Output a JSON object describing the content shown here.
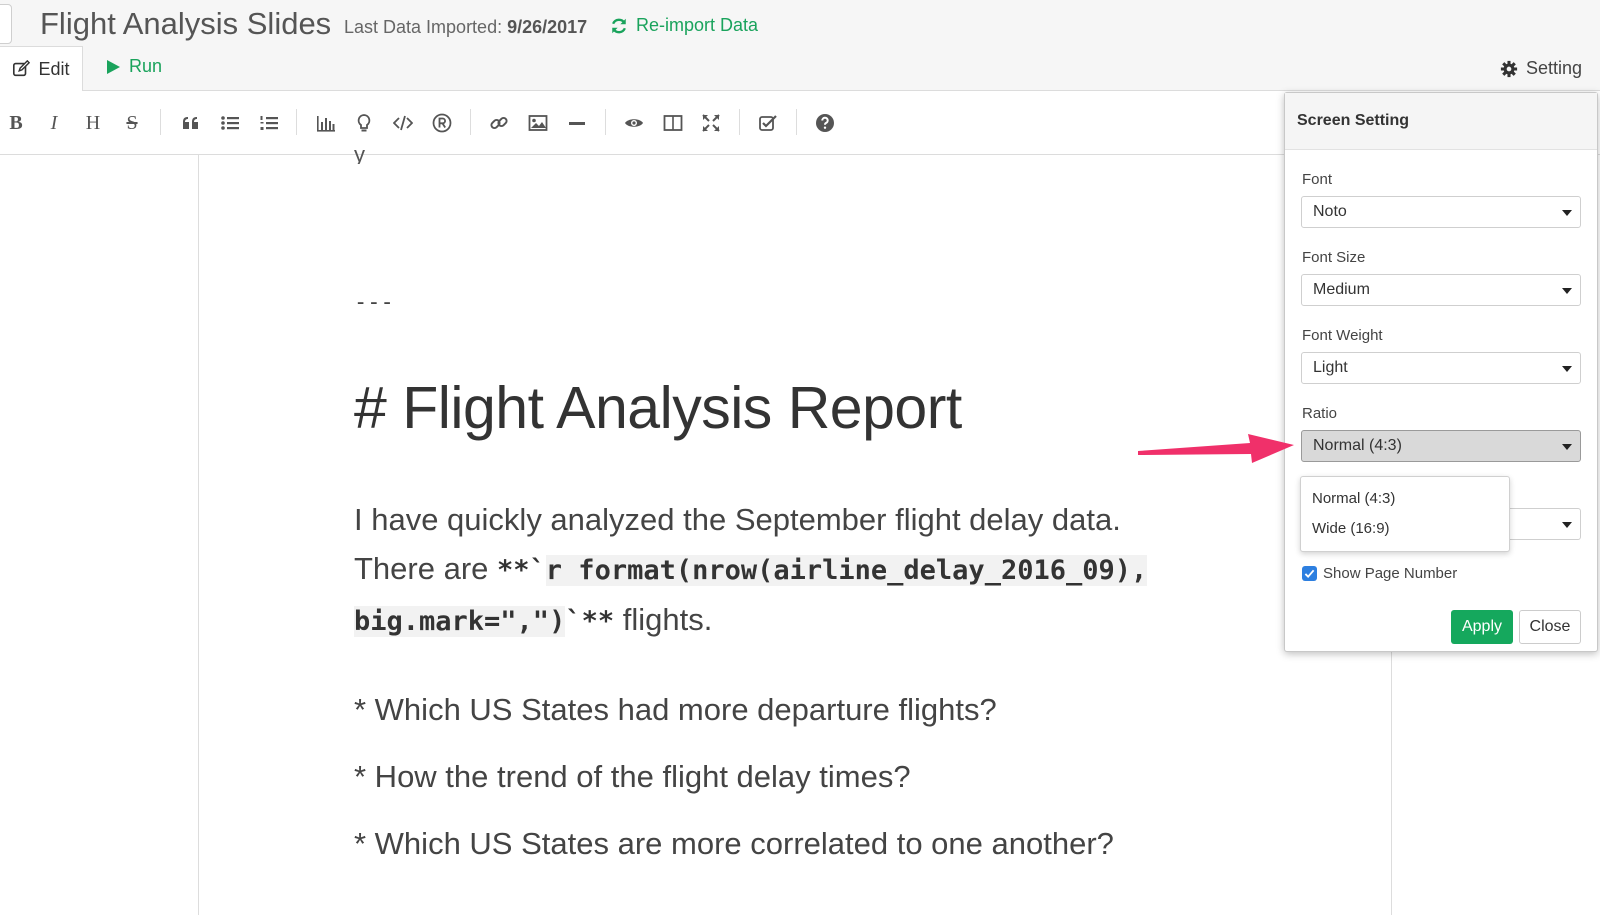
{
  "header": {
    "title": "Flight Analysis Slides",
    "imported_label": "Last Data Imported:",
    "imported_date": "9/26/2017",
    "reimport_label": "Re-import Data"
  },
  "tabs": {
    "edit": "Edit",
    "run": "Run"
  },
  "setting_label": "Setting",
  "toolbar": {
    "items": [
      "bold",
      "italic",
      "heading",
      "strikethrough",
      "quote",
      "unordered-list",
      "ordered-list",
      "chart",
      "hint",
      "code",
      "registered",
      "link",
      "image",
      "horizontal-rule",
      "preview",
      "side-by-side",
      "fullscreen",
      "checklist",
      "help"
    ],
    "bold": "B",
    "italic": "I",
    "heading": "H",
    "strike": "S"
  },
  "editor": {
    "clipped_line": "y",
    "separator": "---",
    "heading": "# Flight Analysis Report",
    "para_line1": "I have quickly analyzed the September flight delay data.",
    "para_there_are": "There are ",
    "para_stars_open": "**`",
    "para_code1": "r format(nrow(airline_delay_2016_09),",
    "para_code2": "big.mark=\",\")",
    "para_stars_close": "`**",
    "para_flights": " flights.",
    "bullets": [
      "* Which US States had more departure flights?",
      "* How the trend of the flight delay times?",
      "* Which US States are more correlated to one another?"
    ]
  },
  "screen_setting": {
    "title": "Screen Setting",
    "font_label": "Font",
    "font_value": "Noto",
    "font_size_label": "Font Size",
    "font_size_value": "Medium",
    "font_weight_label": "Font Weight",
    "font_weight_value": "Light",
    "ratio_label": "Ratio",
    "ratio_value": "Normal (4:3)",
    "ratio_options": [
      "Normal (4:3)",
      "Wide (16:9)"
    ],
    "show_page_number_label": "Show Page Number",
    "show_page_number_checked": true,
    "apply_label": "Apply",
    "close_label": "Close"
  },
  "colors": {
    "accent_green": "#1aa35c",
    "apply_green": "#15a85d",
    "arrow_pink": "#f0306a",
    "checkbox_blue": "#2d7fe0"
  }
}
